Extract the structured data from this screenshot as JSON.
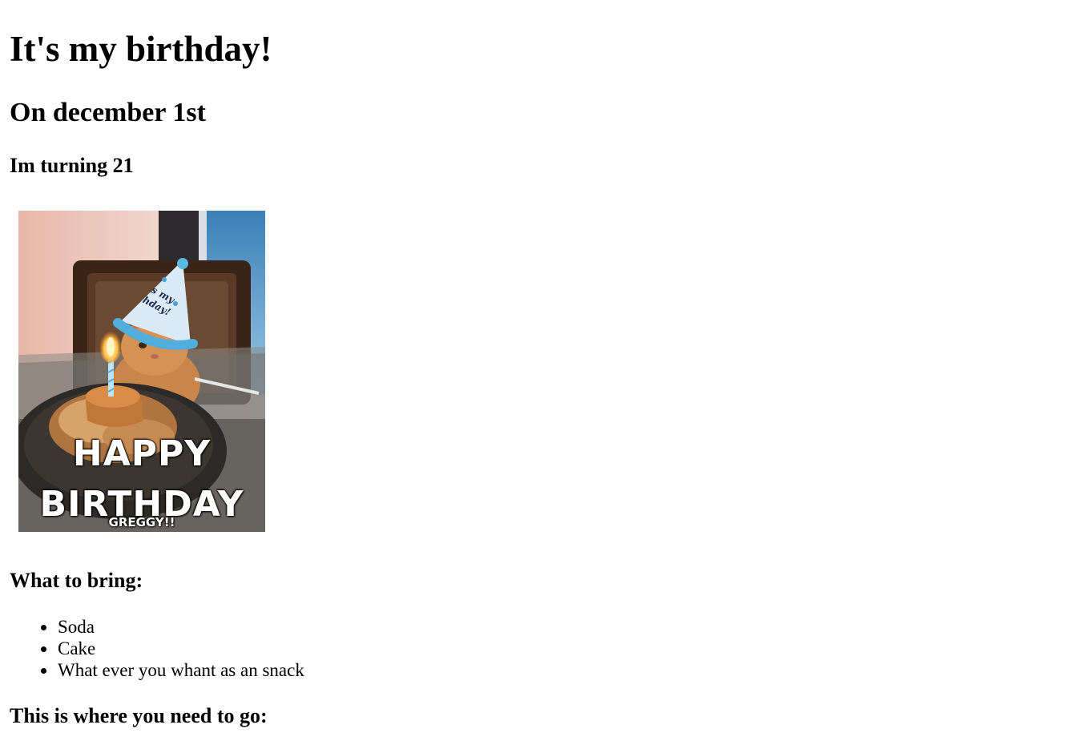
{
  "page": {
    "title": "It's my birthday!",
    "date": "On december 1st",
    "age": "Im turning 21"
  },
  "photo": {
    "caption_line1": "HAPPY",
    "caption_line2": "BIRTHDAY",
    "caption_name": "GREGGY!!",
    "hat_text_line1": "s my",
    "hat_text_line2": "hday!"
  },
  "bring": {
    "heading": "What to bring:",
    "items": [
      "Soda",
      "Cake",
      "What ever you whant as an snack"
    ]
  },
  "location": {
    "heading": "This is where you need to go:"
  }
}
